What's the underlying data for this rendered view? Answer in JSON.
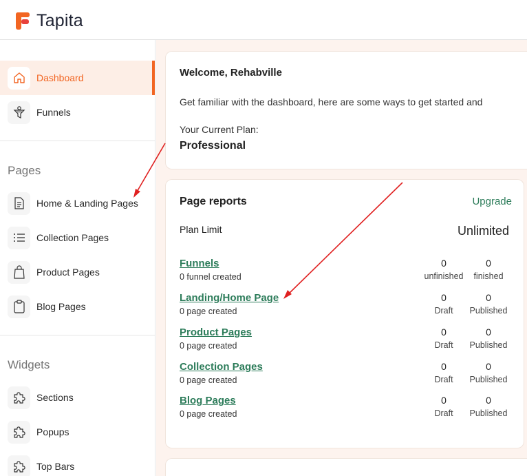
{
  "app": {
    "brand": "Tapita",
    "brand_color": "#f26522",
    "accent_green": "#2e7d5b"
  },
  "sidebar": {
    "items": [
      {
        "label": "Dashboard",
        "icon": "home-icon",
        "active": true
      },
      {
        "label": "Funnels",
        "icon": "funnel-icon",
        "active": false
      }
    ],
    "pages_title": "Pages",
    "pages": [
      {
        "label": "Home & Landing Pages",
        "icon": "document-icon"
      },
      {
        "label": "Collection Pages",
        "icon": "list-icon"
      },
      {
        "label": "Product Pages",
        "icon": "shopping-bag-icon"
      },
      {
        "label": "Blog Pages",
        "icon": "clipboard-icon"
      }
    ],
    "widgets_title": "Widgets",
    "widgets": [
      {
        "label": "Sections",
        "icon": "puzzle-icon"
      },
      {
        "label": "Popups",
        "icon": "puzzle-icon"
      },
      {
        "label": "Top Bars",
        "icon": "puzzle-icon"
      }
    ]
  },
  "welcome": {
    "title": "Welcome, Rehabville",
    "subtitle": "Get familiar with the dashboard, here are some ways to get started and",
    "plan_label": "Your Current Plan:",
    "plan": "Professional"
  },
  "reports": {
    "title": "Page reports",
    "upgrade": "Upgrade",
    "limit_label": "Plan Limit",
    "limit_value": "Unlimited",
    "rows": [
      {
        "name": "Funnels",
        "sub": "0 funnel created",
        "a_num": "0",
        "a_lbl": "unfinished",
        "b_num": "0",
        "b_lbl": "finished"
      },
      {
        "name": "Landing/Home Page",
        "sub": "0 page created",
        "a_num": "0",
        "a_lbl": "Draft",
        "b_num": "0",
        "b_lbl": "Published"
      },
      {
        "name": "Product Pages",
        "sub": "0 page created",
        "a_num": "0",
        "a_lbl": "Draft",
        "b_num": "0",
        "b_lbl": "Published"
      },
      {
        "name": "Collection Pages",
        "sub": "0 page created",
        "a_num": "0",
        "a_lbl": "Draft",
        "b_num": "0",
        "b_lbl": "Published"
      },
      {
        "name": "Blog Pages",
        "sub": "0 page created",
        "a_num": "0",
        "a_lbl": "Draft",
        "b_num": "0",
        "b_lbl": "Published"
      }
    ]
  }
}
